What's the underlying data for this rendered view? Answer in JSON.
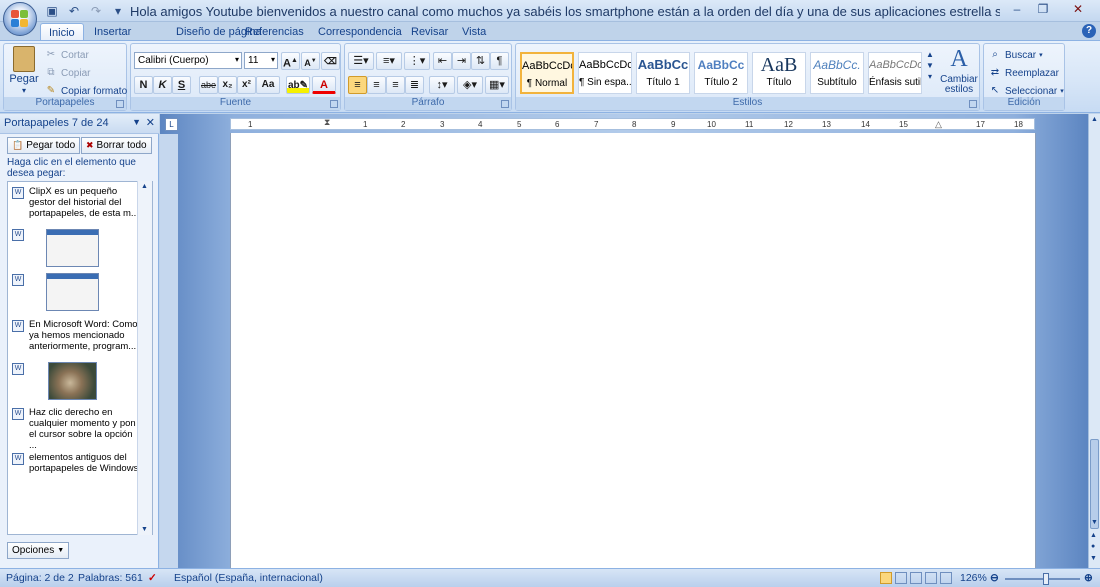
{
  "window": {
    "title": "Hola amigos Youtube bienvenidos a nuestro canal como muchos ya sabéis los smartphone están a la orden del día y una de sus aplicaciones estrella son los client..."
  },
  "tabs": [
    "Inicio",
    "Insertar",
    "Diseño de página",
    "Referencias",
    "Correspondencia",
    "Revisar",
    "Vista"
  ],
  "ribbon": {
    "clipboard": {
      "paste": "Pegar",
      "cut": "Cortar",
      "copy": "Copiar",
      "format_painter": "Copiar formato",
      "label": "Portapapeles"
    },
    "font": {
      "name": "Calibri (Cuerpo)",
      "size": "11",
      "label": "Fuente",
      "bold": "N",
      "italic": "K",
      "underline": "S",
      "strike": "abe",
      "sub": "x₂",
      "sup": "x²",
      "case": "Aa",
      "color_a": "A"
    },
    "paragraph": {
      "label": "Párrafo"
    },
    "styles": {
      "label": "Estilos",
      "items": [
        {
          "sample": "AaBbCcDc",
          "name": "¶ Normal"
        },
        {
          "sample": "AaBbCcDc",
          "name": "¶ Sin espa..."
        },
        {
          "sample": "AaBbCc",
          "name": "Título 1"
        },
        {
          "sample": "AaBbCc",
          "name": "Título 2"
        },
        {
          "sample": "AaB",
          "name": "Título"
        },
        {
          "sample": "AaBbCc.",
          "name": "Subtítulo"
        },
        {
          "sample": "AaBbCcDc",
          "name": "Énfasis sutil"
        }
      ],
      "change": "Cambiar estilos"
    },
    "editing": {
      "label": "Edición",
      "find": "Buscar",
      "replace": "Reemplazar",
      "select": "Seleccionar"
    }
  },
  "clipboard_pane": {
    "title": "Portapapeles 7 de 24",
    "paste_all": "Pegar todo",
    "clear_all": "Borrar todo",
    "instruction": "Haga clic en el elemento que desea pegar:",
    "items": [
      {
        "text": "ClipX es un pequeño gestor del historial del portapapeles, de esta m..."
      },
      {
        "text": ""
      },
      {
        "text": ""
      },
      {
        "text": "En Microsoft Word: Como ya hemos mencionado anteriormente, program..."
      },
      {
        "text": ""
      },
      {
        "text": "Haz clic derecho en cualquier momento y pon el cursor sobre la opción ..."
      },
      {
        "text": "elementos antiguos del portapapeles de Windows"
      }
    ],
    "options": "Opciones"
  },
  "ruler": {
    "numbers": [
      "1",
      "1",
      "2",
      "3",
      "4",
      "5",
      "6",
      "7",
      "8",
      "9",
      "10",
      "11",
      "12",
      "13",
      "14",
      "15",
      "16",
      "17",
      "18"
    ]
  },
  "status": {
    "page": "Página: 2 de 2",
    "words": "Palabras: 561",
    "language": "Español (España, internacional)",
    "zoom": "126%"
  },
  "colors": {
    "accent": "#15428b",
    "ribbon": "#d6e5f7",
    "selected_style": "#f2b33d"
  }
}
